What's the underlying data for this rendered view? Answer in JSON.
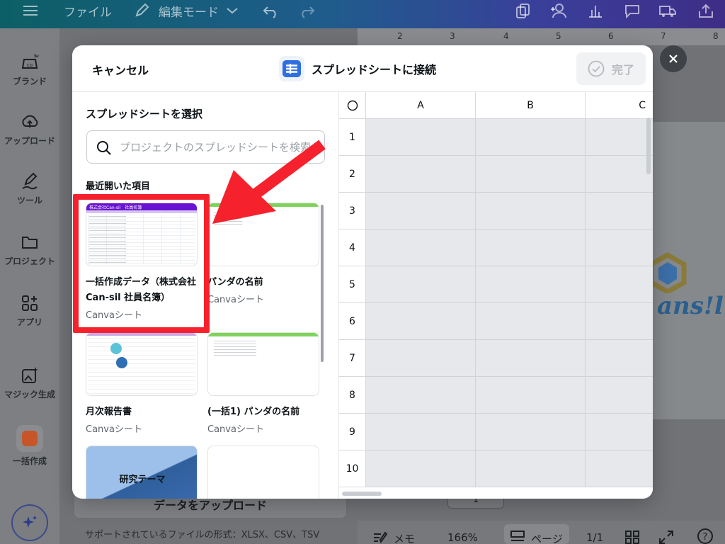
{
  "topbar": {
    "file_label": "ファイル",
    "mode_label": "編集モード"
  },
  "rail": {
    "items": [
      {
        "label": "ブランド",
        "icon": "brand-icon"
      },
      {
        "label": "アップロード",
        "icon": "upload-cloud-icon"
      },
      {
        "label": "ツール",
        "icon": "pen-icon"
      },
      {
        "label": "プロジェクト",
        "icon": "folder-icon"
      },
      {
        "label": "アプリ",
        "icon": "apps-icon"
      },
      {
        "label": "マジック生成",
        "icon": "magic-image-icon"
      },
      {
        "label": "一括作成",
        "icon": "bulk-create-icon"
      }
    ]
  },
  "ruler": {
    "ticks": [
      "2",
      "3",
      "4",
      "5",
      "6",
      "7",
      "8"
    ]
  },
  "background": {
    "upload_button": "データをアップロード",
    "support_text": "サポートされているファイルの形式：XLSX、CSV、TSV",
    "bottom": {
      "notes": "メモ",
      "zoom": "166%",
      "page": "ページ",
      "page_count": "1/1"
    },
    "page_indicator": "1",
    "logo_text": "ans!l"
  },
  "modal": {
    "cancel_label": "キャンセル",
    "title": "スプレッドシートに接続",
    "done_label": "完了",
    "pick_title": "スプレッドシートを選択",
    "search_placeholder": "プロジェクトのスプレッドシートを検索",
    "recent_title": "最近開いた項目",
    "cards": [
      {
        "name": "一括作成データ（株式会社Can-sil 社員名簿）",
        "sub": "Canvaシート",
        "accent": "#6a12d1",
        "thumb_header": "株式会社Can-sil　社員名簿"
      },
      {
        "name": "パンダの名前",
        "sub": "Canvaシート",
        "accent": "#7fd35a"
      },
      {
        "name": "月次報告書",
        "sub": "Canvaシート",
        "accent": "#c9a7e6"
      },
      {
        "name": "(一括1) パンダの名前",
        "sub": "Canvaシート",
        "accent": "#7fd35a"
      },
      {
        "name": "研究テーマ",
        "sub": "",
        "accent": "#3c6bb0"
      },
      {
        "name": "",
        "sub": "",
        "accent": "#e0e2e5"
      }
    ],
    "grid": {
      "corner": "○",
      "columns": [
        "A",
        "B",
        "C"
      ],
      "rows": [
        "1",
        "2",
        "3",
        "4",
        "5",
        "6",
        "7",
        "8",
        "9",
        "10"
      ]
    }
  },
  "colors": {
    "highlight": "#f5222d",
    "topbar_start": "#0c5f66",
    "topbar_end": "#3e2d86"
  }
}
